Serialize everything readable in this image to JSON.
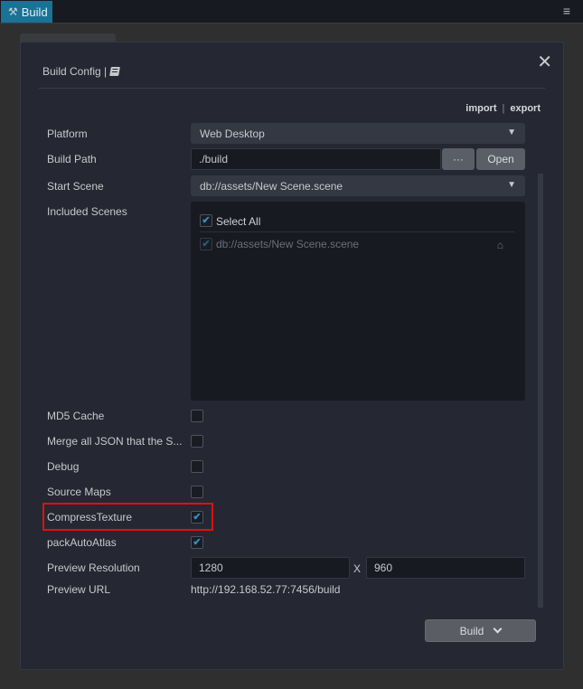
{
  "topbar": {
    "tab_label": "Build",
    "tab_icon": "hammer-wrench-icon",
    "menu_icon": "hamburger-menu-icon"
  },
  "panel": {
    "title": "Build Config |",
    "title_icon": "book-icon",
    "close_icon": "close-icon",
    "import_label": "import",
    "export_label": "export",
    "io_separator": "|"
  },
  "form": {
    "platform": {
      "label": "Platform",
      "value": "Web Desktop"
    },
    "build_path": {
      "label": "Build Path",
      "value": "./build",
      "browse_label": "···",
      "open_label": "Open"
    },
    "start_scene": {
      "label": "Start Scene",
      "value": "db://assets/New Scene.scene"
    },
    "included_scenes": {
      "label": "Included Scenes",
      "select_all_label": "Select All",
      "select_all_checked": true,
      "items": [
        {
          "path": "db://assets/New Scene.scene",
          "checked": true,
          "disabled": true,
          "icon": "home-icon"
        }
      ]
    },
    "md5_cache": {
      "label": "MD5 Cache",
      "checked": false
    },
    "merge_json": {
      "label": "Merge all JSON that the S...",
      "checked": false
    },
    "debug": {
      "label": "Debug",
      "checked": false
    },
    "source_maps": {
      "label": "Source Maps",
      "checked": false
    },
    "compress_texture": {
      "label": "CompressTexture",
      "checked": true,
      "highlighted": true
    },
    "pack_auto_atlas": {
      "label": "packAutoAtlas",
      "checked": true
    },
    "preview_resolution": {
      "label": "Preview Resolution",
      "width": "1280",
      "separator": "X",
      "height": "960"
    },
    "preview_url": {
      "label": "Preview URL",
      "value": "http://192.168.52.77:7456/build"
    }
  },
  "footer": {
    "build_label": "Build"
  },
  "colors": {
    "accent": "#1a7295",
    "check": "#2d93c2",
    "highlight": "#e01010"
  }
}
